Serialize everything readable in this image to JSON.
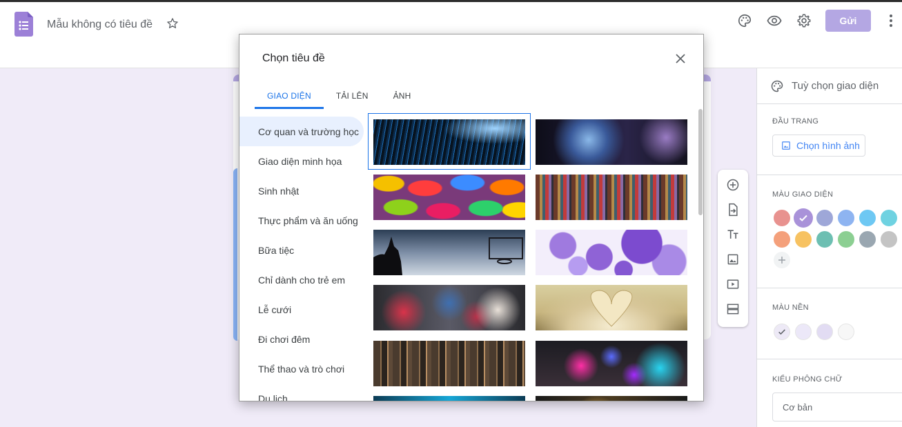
{
  "app": {
    "doc_title": "Mẫu không có tiêu đề",
    "send_label": "Gửi",
    "brand_color": "#673ab7",
    "send_color": "#b4a7e3"
  },
  "top_icons": [
    "palette-icon",
    "eye-icon",
    "gear-icon",
    "more-vertical-icon"
  ],
  "float_toolbar_icons": [
    "add-circle-icon",
    "import-icon",
    "title-text-icon",
    "image-icon",
    "video-icon",
    "section-icon"
  ],
  "theme_panel": {
    "title": "Tuỳ chọn giao diện",
    "header_label": "ĐẦU TRANG",
    "choose_image_label": "Chọn hình ảnh",
    "theme_color_label": "MÀU GIAO DIỆN",
    "theme_colors": [
      "#e8928f",
      "#a992d9",
      "#9ea7d8",
      "#8eb4f1",
      "#6ec8f3",
      "#6fd2e1",
      "#f4a07b",
      "#f7c261",
      "#6dbfb2",
      "#8ccf92",
      "#9aa7b1",
      "#c4c4c4"
    ],
    "selected_theme_color": "#a992d9",
    "background_color_label": "MÀU NỀN",
    "background_colors": [
      "#ede9f6",
      "#ece8f8",
      "#e2dcf3",
      "#f7f7f7"
    ],
    "font_style_label": "KIỂU PHÔNG CHỮ",
    "font_style_value": "Cơ bản"
  },
  "dialog": {
    "title": "Chọn tiêu đề",
    "tabs": [
      {
        "label": "GIAO DIỆN",
        "active": true
      },
      {
        "label": "TẢI LÊN",
        "active": false
      },
      {
        "label": "ẢNH",
        "active": false
      }
    ],
    "categories": [
      "Cơ quan và trường học",
      "Giao diện minh họa",
      "Sinh nhật",
      "Thực phẩm và ăn uống",
      "Bữa tiệc",
      "Chỉ dành cho trẻ em",
      "Lễ cưới",
      "Đi chơi đêm",
      "Thể thao và trò chơi",
      "Du lịch"
    ],
    "selected_category": "Cơ quan và trường học",
    "thumbnails": [
      "network-lights-image",
      "guitar-image",
      "candy-image",
      "yarn-image",
      "basketball-image",
      "bubbles-image",
      "paint-hands-image",
      "book-heart-image",
      "paintbrushes-image",
      "lab-flasks-image",
      "blue-light-image",
      "bokeh-image"
    ]
  }
}
